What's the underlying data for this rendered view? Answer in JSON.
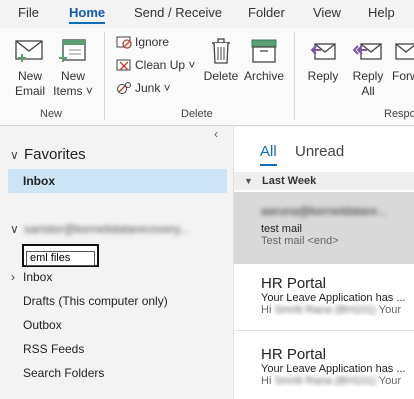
{
  "tabs": [
    "File",
    "Home",
    "Send / Receive",
    "Folder",
    "View",
    "Help"
  ],
  "ribbon": {
    "new_email": [
      "New",
      "Email"
    ],
    "new_items": [
      "New",
      "Items ˅"
    ],
    "ignore": "Ignore",
    "clean_up": "Clean Up ˅",
    "junk": "Junk ˅",
    "delete": "Delete",
    "archive": "Archive",
    "reply": "Reply",
    "reply_all": [
      "Reply",
      "All"
    ],
    "forward": "Forw",
    "groups": {
      "new": "New",
      "delete": "Delete",
      "respond": "Respo"
    }
  },
  "folder_pane": {
    "collapse_glyph": "‹",
    "favorites_label": "Favorites",
    "favorites_inbox": "Inbox",
    "account_email": "saristor@kernelidatarecovery...",
    "rename_value": "eml files",
    "folders": [
      "Inbox",
      "Drafts (This computer only)",
      "Outbox",
      "RSS Feeds",
      "Search Folders"
    ]
  },
  "message_list": {
    "filter_all": "All",
    "filter_unread": "Unread",
    "section": "Last Week",
    "messages": [
      {
        "from": "aaruna@kerneldatare...",
        "subject": "test mail",
        "preview": "Test mail <end>"
      },
      {
        "from": "HR Portal",
        "subject": "Your Leave Application has ...",
        "preview_hi": "Hi",
        "preview_name": "Smriti Rana (BH101)",
        "preview_tail": "Your"
      },
      {
        "from": "HR Portal",
        "subject": "Your Leave Application has ...",
        "preview_hi": "Hi",
        "preview_name": "Smriti Rana (BH101)",
        "preview_tail": "Your"
      }
    ]
  },
  "colors": {
    "accent": "#0f6cbd",
    "selected_fav": "#cde3f6",
    "selected_msg": "#d9d9d9",
    "icon_purple": "#7d55a8",
    "icon_green": "#5a9e72"
  }
}
